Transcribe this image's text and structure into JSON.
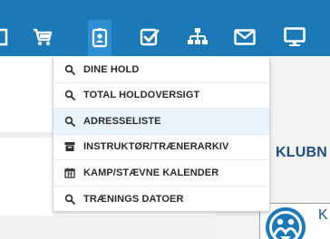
{
  "header": {
    "nav_icons": [
      {
        "name": "nav-partial-icon"
      },
      {
        "name": "shopping-cart-icon"
      },
      {
        "name": "id-badge-icon",
        "active": true
      },
      {
        "name": "check-square-icon"
      },
      {
        "name": "sitemap-icon"
      },
      {
        "name": "envelope-icon"
      },
      {
        "name": "desktop-icon"
      }
    ],
    "colors": {
      "bar": "#1c79b8",
      "active": "#2e8fd3",
      "icon": "#ffffff"
    }
  },
  "dropdown": {
    "items": [
      {
        "label": "DINE HOLD",
        "icon": "search-icon"
      },
      {
        "label": "TOTAL HOLDOVERSIGT",
        "icon": "search-icon"
      },
      {
        "label": "ADRESSELISTE",
        "icon": "search-icon",
        "active": true
      },
      {
        "label": "INSTRUKTØR/TRÆNERARKIV",
        "icon": "archive-icon"
      },
      {
        "label": "KAMP/STÆVNE KALENDER",
        "icon": "calendar-icon"
      },
      {
        "label": "TRÆNINGS DATOER",
        "icon": "search-icon"
      }
    ]
  },
  "main": {
    "club_title": "KLUBN",
    "club_card_letter": "K"
  }
}
